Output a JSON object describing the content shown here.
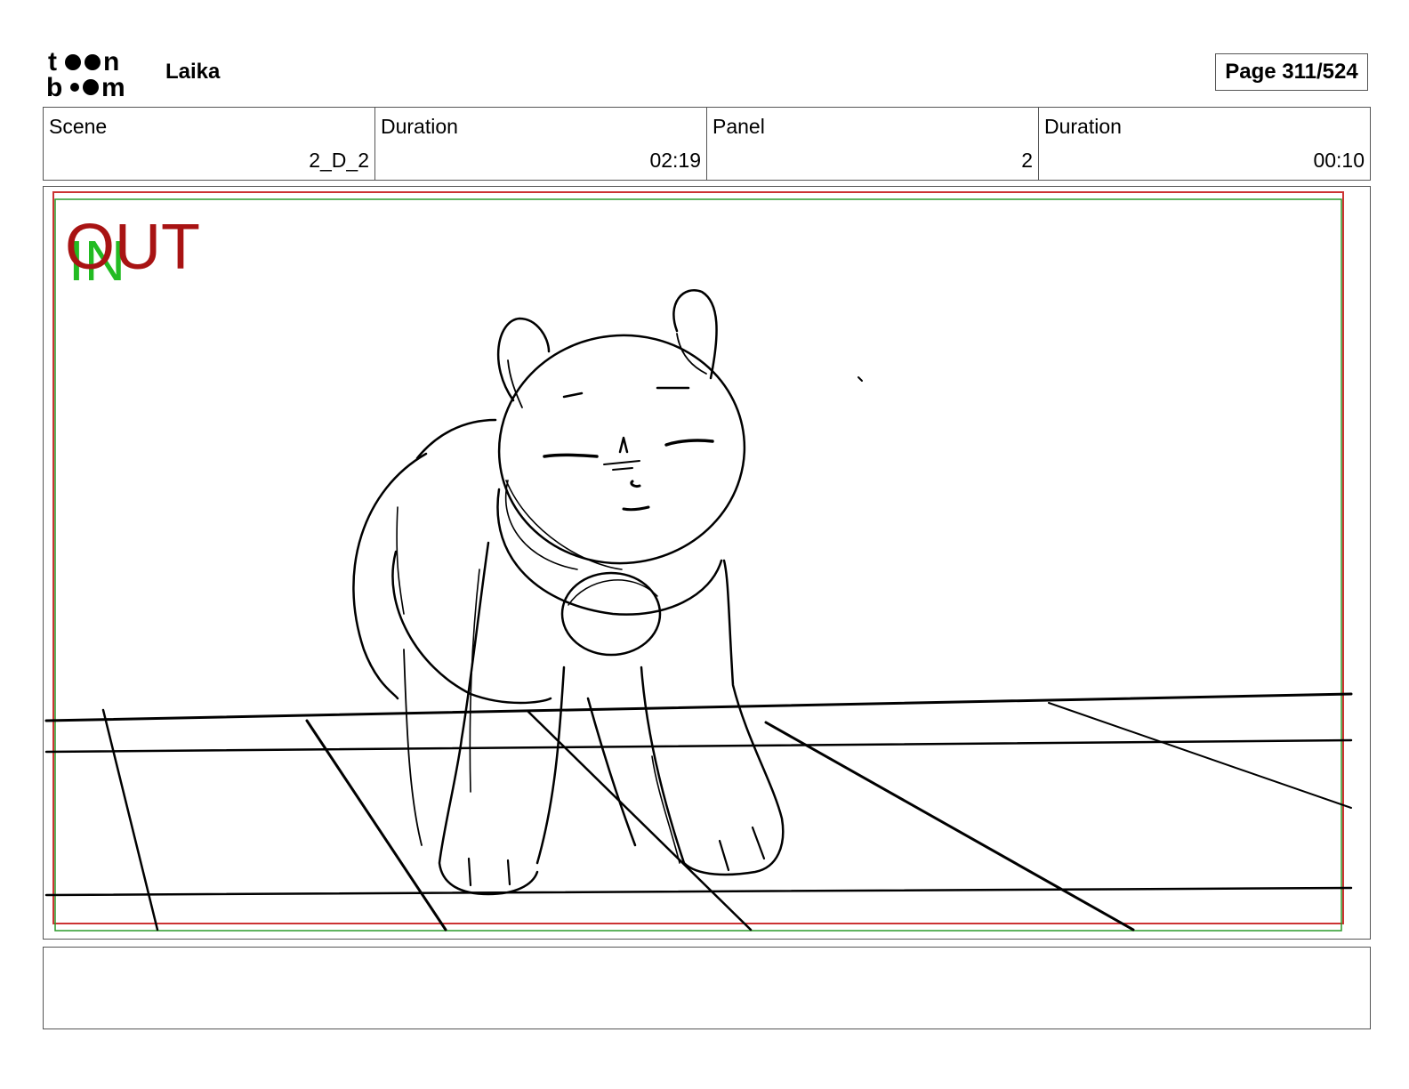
{
  "header": {
    "logo_text": "toon boom",
    "project_title": "Laika",
    "page_label": "Page 311/524"
  },
  "info": [
    {
      "label": "Scene",
      "value": "2_D_2"
    },
    {
      "label": "Duration",
      "value": "02:19"
    },
    {
      "label": "Panel",
      "value": "2"
    },
    {
      "label": "Duration",
      "value": "00:10"
    }
  ],
  "panel": {
    "marker_out": "OUT",
    "marker_in": "IN",
    "colors": {
      "out_marker": "#a81313",
      "in_marker": "#22bb22",
      "safe_frame_red": "#cc3333",
      "safe_frame_green": "#2a9a2a"
    }
  },
  "caption": {
    "text": ""
  }
}
